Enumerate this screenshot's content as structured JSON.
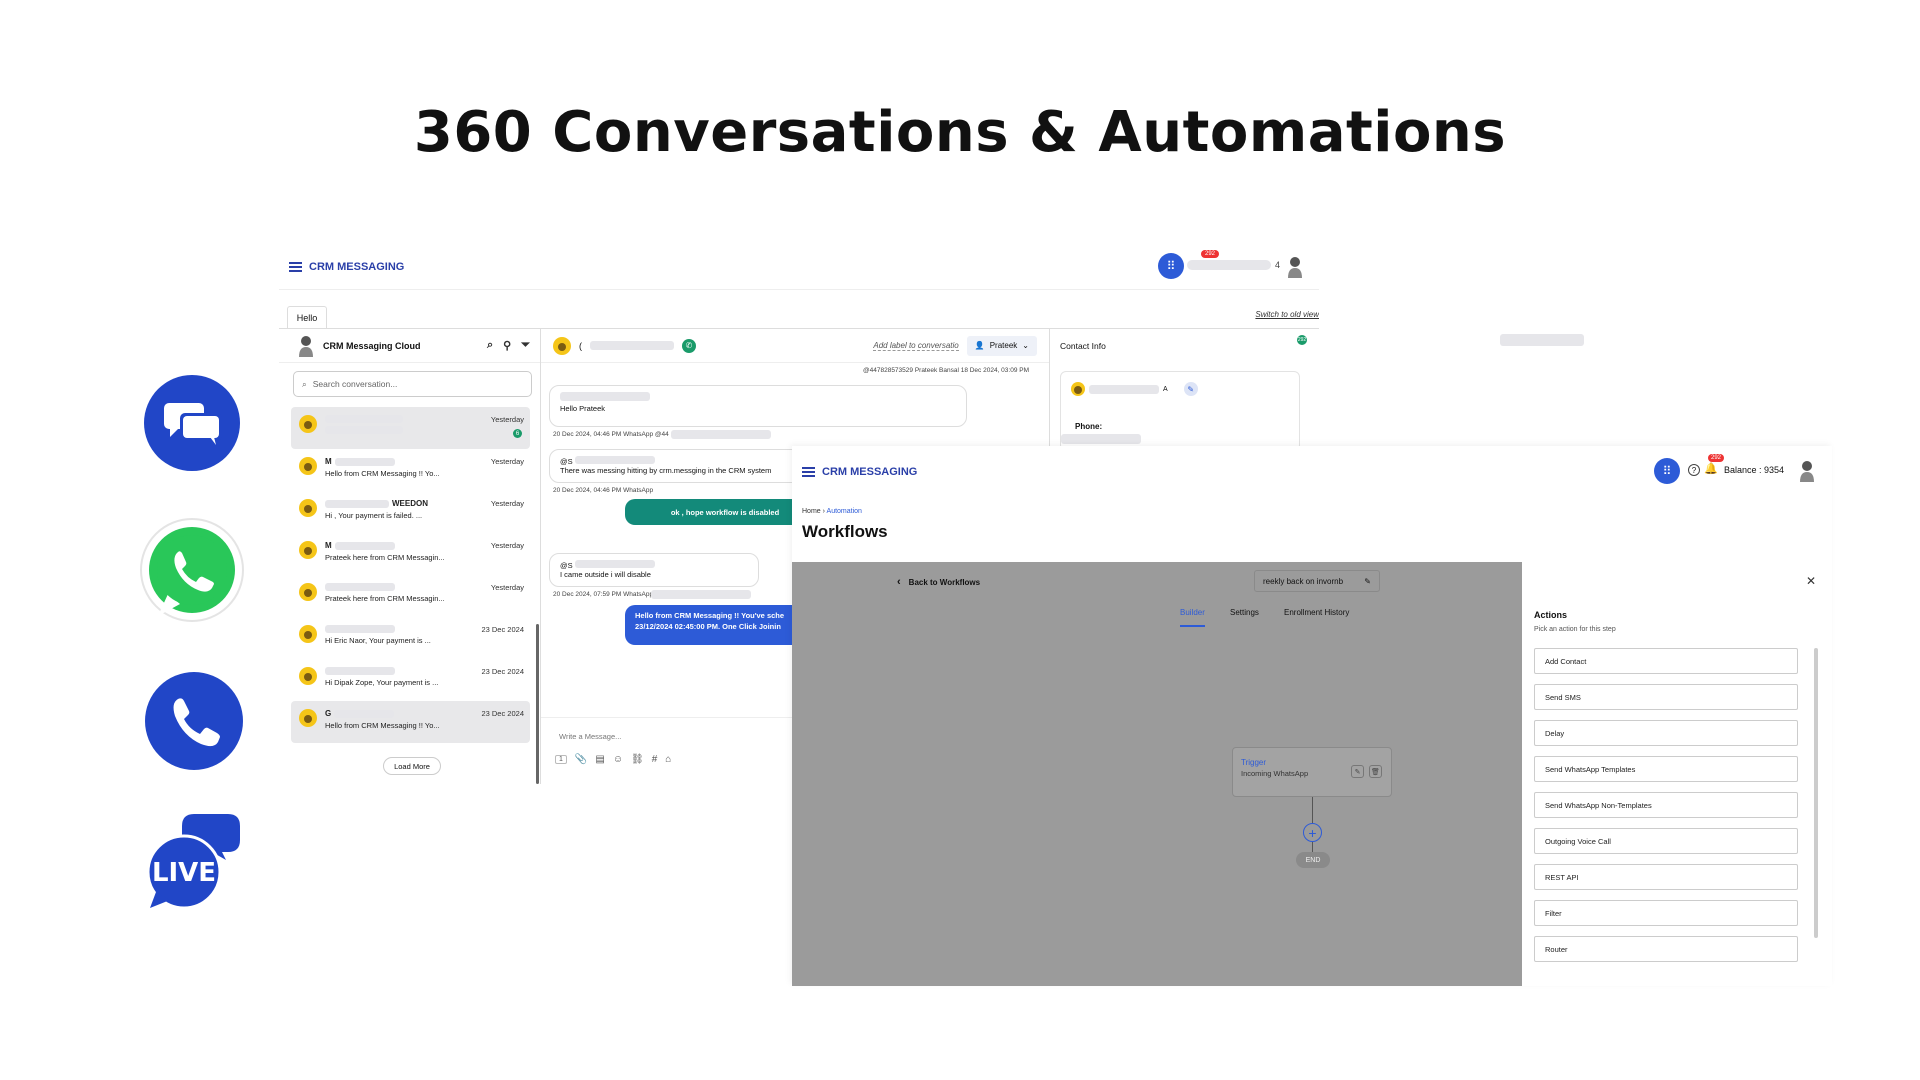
{
  "page": {
    "title": "360 Conversations & Automations"
  },
  "icons": [
    "chat-bubbles-icon",
    "whatsapp-icon",
    "phone-icon",
    "live-chat-icon"
  ],
  "live_icon_text": "LIVE",
  "colors": {
    "brand_blue": "#2146c7",
    "whatsapp_green": "#25d366",
    "teal": "#138a7a",
    "message_blue": "#2d5bd7"
  },
  "messaging": {
    "brand": "CRM MESSAGING",
    "notification_count": "292",
    "header_trailing": "4",
    "tab": "Hello",
    "switch_link": "Switch to old view",
    "list_title": "CRM Messaging Cloud",
    "search_placeholder": "Search conversation...",
    "conversations": [
      {
        "name": "",
        "preview": "",
        "time": "Yesterday",
        "unread": "6",
        "active": true
      },
      {
        "name": "M",
        "preview": "Hello from CRM Messaging !! Yo...",
        "time": "Yesterday"
      },
      {
        "name": "WEEDON",
        "preview": "Hi , Your payment is failed. ...",
        "time": "Yesterday"
      },
      {
        "name": "M",
        "preview": "Prateek here from CRM Messagin...",
        "time": "Yesterday"
      },
      {
        "name": "",
        "preview": "Prateek here from CRM Messagin...",
        "time": "Yesterday"
      },
      {
        "name": "",
        "preview": "Hi Eric Naor, Your payment is ...",
        "time": "23 Dec 2024"
      },
      {
        "name": "",
        "preview": "Hi Dipak Zope, Your payment is ...",
        "time": "23 Dec 2024"
      },
      {
        "name": "G",
        "preview": "Hello from CRM Messaging !! Yo...",
        "time": "23 Dec 2024",
        "active": true
      }
    ],
    "load_more": "Load More",
    "chat_contact_initial": "(",
    "add_label": "Add label to conversatio",
    "assignee": "Prateek",
    "top_meta": "@447828573529   Prateek Bansal   18 Dec 2024, 03:09 PM",
    "messages": [
      {
        "dir": "in",
        "text": "Hello Prateek",
        "meta": "20 Dec 2024, 04:46 PM   WhatsApp   @44"
      },
      {
        "dir": "in",
        "sender": "@S",
        "text": "There was messing hitting by crm.messging in the CRM system",
        "meta": "20 Dec 2024, 04:46 PM   WhatsApp"
      },
      {
        "dir": "out",
        "text": "ok , hope workflow is disabled"
      },
      {
        "dir": "in",
        "sender": "@S",
        "text": "I came outside i will disable",
        "meta": "20 Dec 2024, 07:59 PM   WhatsApp"
      },
      {
        "dir": "out",
        "text": "Hello from CRM Messaging !! You've sche\n23/12/2024 02:45:00 PM. One Click Joinin"
      }
    ],
    "composer_placeholder": "Write a Message...",
    "composer_count": "1",
    "contact_info_title": "Contact Info",
    "contact_badge": "292",
    "contact_card_suffix": "A",
    "phone_label": "Phone:"
  },
  "automation": {
    "brand": "CRM MESSAGING",
    "notification_count": "292",
    "balance": "Balance : 9354",
    "breadcrumb_home": "Home",
    "breadcrumb_current": "Automation",
    "title": "Workflows",
    "back_label": "Back to Workflows",
    "workflow_name": "reekly back on invornb",
    "tabs": [
      "Builder",
      "Settings",
      "Enrollment History"
    ],
    "trigger_title": "Trigger",
    "trigger_sub": "Incoming WhatsApp",
    "end_label": "END",
    "actions_title": "Actions",
    "actions_subtitle": "Pick an action for this step",
    "actions": [
      "Add Contact",
      "Send SMS",
      "Delay",
      "Send WhatsApp Templates",
      "Send WhatsApp Non-Templates",
      "Outgoing Voice Call",
      "REST API",
      "Filter",
      "Router"
    ]
  }
}
